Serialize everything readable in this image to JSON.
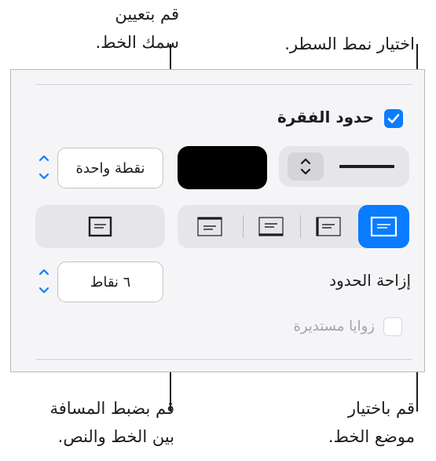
{
  "callouts": {
    "line_thickness": [
      "قم بتعيين",
      "سمك الخط."
    ],
    "line_style": [
      "اختيار نمط السطر."
    ],
    "border_offset": [
      "قم بضبط المسافة",
      "بين الخط والنص."
    ],
    "border_position": [
      "قم باختيار",
      "موضع الخط."
    ]
  },
  "panel": {
    "paragraph_borders_label": "حدود الفقرة",
    "paragraph_borders_checked": true,
    "line_width_value": "نقطة واحدة",
    "line_color": "#000000",
    "border_offset_label": "إزاحة الحدود",
    "border_offset_value": "٦ نقاط",
    "rounded_corners_label": "زوايا مستديرة",
    "rounded_corners_checked": false
  },
  "colors": {
    "accent": "#0a7cff"
  }
}
